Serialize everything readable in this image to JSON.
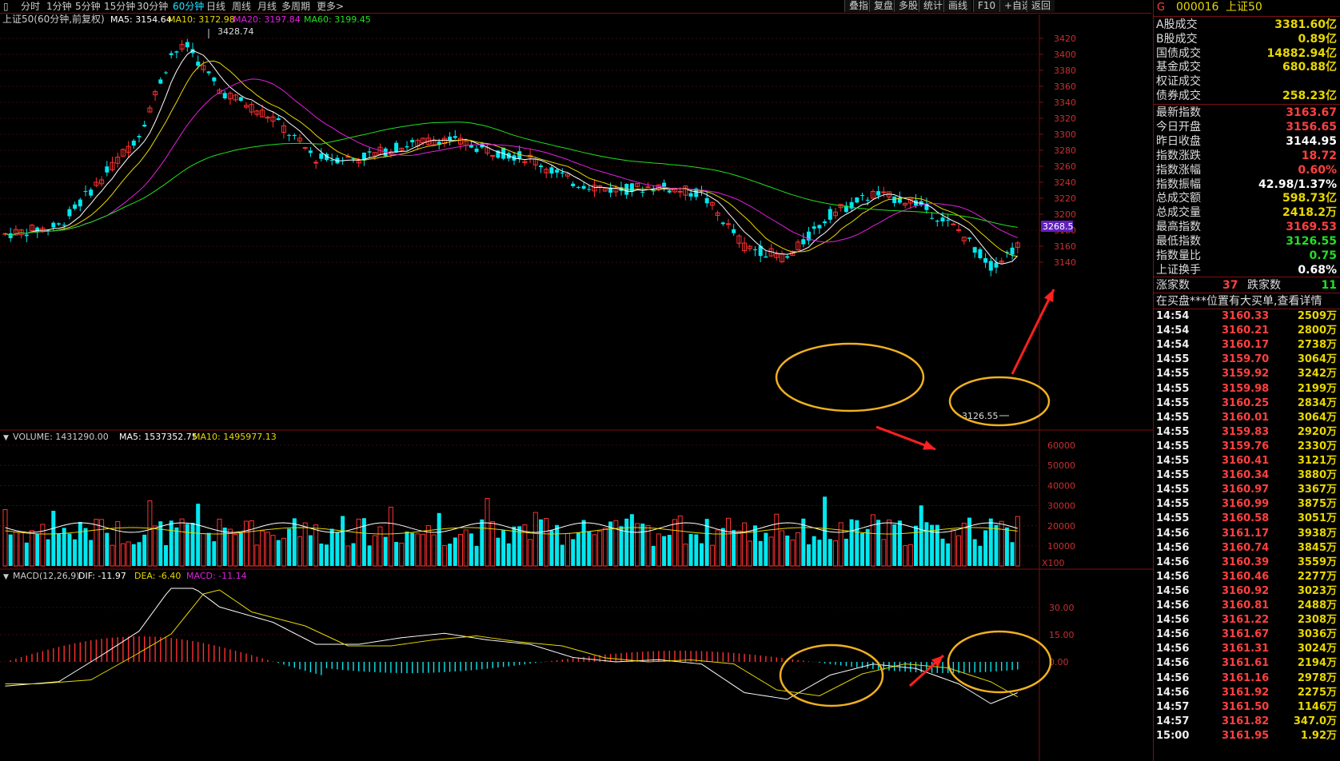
{
  "toolbar": {
    "periods": [
      {
        "label": "分时",
        "active": false
      },
      {
        "label": "1分钟",
        "active": false
      },
      {
        "label": "5分钟",
        "active": false
      },
      {
        "label": "15分钟",
        "active": false
      },
      {
        "label": "30分钟",
        "active": false
      },
      {
        "label": "60分钟",
        "active": true
      },
      {
        "label": "日线",
        "active": false
      },
      {
        "label": "周线",
        "active": false
      },
      {
        "label": "月线",
        "active": false
      },
      {
        "label": "多周期",
        "active": false
      },
      {
        "label": "更多>",
        "active": false
      }
    ],
    "right_buttons": [
      "叠指",
      "复盘",
      "多股",
      "统计",
      "画线",
      "F10",
      "+自选",
      "返回"
    ]
  },
  "main_chart": {
    "title": "上证50(60分钟,前复权)",
    "ma_legend": [
      {
        "label": "MA5: 3154.64",
        "color": "#ffffff"
      },
      {
        "label": "MA10: 3172.98",
        "color": "#e8d800"
      },
      {
        "label": "MA20: 3197.84",
        "color": "#e020e0"
      },
      {
        "label": "MA60: 3199.45",
        "color": "#20e020"
      }
    ],
    "y_ticks": [
      "3420",
      "3400",
      "3380",
      "3360",
      "3340",
      "3320",
      "3300",
      "3280",
      "3260",
      "3240",
      "3220",
      "3200",
      "3180",
      "3160",
      "3140"
    ],
    "current_price_tag": "3268.5",
    "high_label": "3428.74",
    "low_label": "3126.55",
    "high": 3428.74,
    "low": 3126.55
  },
  "volume_chart": {
    "legend": [
      {
        "label": "VOLUME: 1431290.00",
        "color": "#cccccc"
      },
      {
        "label": "MA5: 1537352.75",
        "color": "#ffffff"
      },
      {
        "label": "MA10: 1495977.13",
        "color": "#e8d800"
      }
    ],
    "y_ticks": [
      "60000",
      "50000",
      "40000",
      "30000",
      "20000",
      "10000"
    ],
    "unit": "X100"
  },
  "macd_chart": {
    "legend": [
      {
        "label": "MACD(12,26,9)",
        "color": "#cccccc"
      },
      {
        "label": "DIF: -11.97",
        "color": "#ffffff"
      },
      {
        "label": "DEA: -6.40",
        "color": "#e8d800"
      },
      {
        "label": "MACD: -11.14",
        "color": "#e020e0"
      }
    ],
    "y_ticks": [
      "30.00",
      "15.00",
      "0.00"
    ]
  },
  "panel": {
    "code": "000016",
    "name": "上证50",
    "market_rows": [
      {
        "label": "A股成交",
        "value": "3381.60亿",
        "color": "#e8d800"
      },
      {
        "label": "B股成交",
        "value": "0.89亿",
        "color": "#e8d800"
      },
      {
        "label": "国债成交",
        "value": "14882.94亿",
        "color": "#e8d800"
      },
      {
        "label": "基金成交",
        "value": "680.88亿",
        "color": "#e8d800"
      },
      {
        "label": "权证成交",
        "value": "",
        "color": "#e8d800"
      },
      {
        "label": "债券成交",
        "value": "258.23亿",
        "color": "#e8d800"
      }
    ],
    "index_rows": [
      {
        "label": "最新指数",
        "value": "3163.67",
        "color": "#ff4040"
      },
      {
        "label": "今日开盘",
        "value": "3156.65",
        "color": "#ff4040"
      },
      {
        "label": "昨日收盘",
        "value": "3144.95",
        "color": "#ffffff"
      },
      {
        "label": "指数涨跌",
        "value": "18.72",
        "color": "#ff4040"
      },
      {
        "label": "指数涨幅",
        "value": "0.60%",
        "color": "#ff4040"
      },
      {
        "label": "指数振幅",
        "value": "42.98/1.37%",
        "color": "#ffffff"
      },
      {
        "label": "总成交额",
        "value": "598.73亿",
        "color": "#e8d800"
      },
      {
        "label": "总成交量",
        "value": "2418.2万",
        "color": "#e8d800"
      },
      {
        "label": "最高指数",
        "value": "3169.53",
        "color": "#ff4040"
      },
      {
        "label": "最低指数",
        "value": "3126.55",
        "color": "#20e020"
      },
      {
        "label": "指数量比",
        "value": "0.75",
        "color": "#20e020"
      },
      {
        "label": "上证换手",
        "value": "0.68%",
        "color": "#ffffff"
      }
    ],
    "breadth": {
      "up_label": "涨家数",
      "up_value": "37",
      "down_label": "跌家数",
      "down_value": "11"
    },
    "notice": "在买盘***位置有大买单,查看详情",
    "ticks": [
      {
        "t": "14:54",
        "p": "3160.33",
        "v": "2509万"
      },
      {
        "t": "14:54",
        "p": "3160.21",
        "v": "2800万"
      },
      {
        "t": "14:54",
        "p": "3160.17",
        "v": "2738万"
      },
      {
        "t": "14:55",
        "p": "3159.70",
        "v": "3064万"
      },
      {
        "t": "14:55",
        "p": "3159.92",
        "v": "3242万"
      },
      {
        "t": "14:55",
        "p": "3159.98",
        "v": "2199万"
      },
      {
        "t": "14:55",
        "p": "3160.25",
        "v": "2834万"
      },
      {
        "t": "14:55",
        "p": "3160.01",
        "v": "3064万"
      },
      {
        "t": "14:55",
        "p": "3159.83",
        "v": "2920万"
      },
      {
        "t": "14:55",
        "p": "3159.76",
        "v": "2330万"
      },
      {
        "t": "14:55",
        "p": "3160.41",
        "v": "3121万"
      },
      {
        "t": "14:55",
        "p": "3160.34",
        "v": "3880万"
      },
      {
        "t": "14:55",
        "p": "3160.97",
        "v": "3367万"
      },
      {
        "t": "14:55",
        "p": "3160.99",
        "v": "3875万"
      },
      {
        "t": "14:55",
        "p": "3160.58",
        "v": "3051万"
      },
      {
        "t": "14:56",
        "p": "3161.17",
        "v": "3938万"
      },
      {
        "t": "14:56",
        "p": "3160.74",
        "v": "3845万"
      },
      {
        "t": "14:56",
        "p": "3160.39",
        "v": "3559万"
      },
      {
        "t": "14:56",
        "p": "3160.46",
        "v": "2277万"
      },
      {
        "t": "14:56",
        "p": "3160.92",
        "v": "3023万"
      },
      {
        "t": "14:56",
        "p": "3160.81",
        "v": "2488万"
      },
      {
        "t": "14:56",
        "p": "3161.22",
        "v": "2308万"
      },
      {
        "t": "14:56",
        "p": "3161.67",
        "v": "3036万"
      },
      {
        "t": "14:56",
        "p": "3161.31",
        "v": "3024万"
      },
      {
        "t": "14:56",
        "p": "3161.61",
        "v": "2194万"
      },
      {
        "t": "14:56",
        "p": "3161.16",
        "v": "2978万"
      },
      {
        "t": "14:56",
        "p": "3161.92",
        "v": "2275万"
      },
      {
        "t": "14:57",
        "p": "3161.50",
        "v": "1146万"
      },
      {
        "t": "14:57",
        "p": "3161.82",
        "v": "347.0万"
      },
      {
        "t": "15:00",
        "p": "3161.95",
        "v": "1.92万"
      }
    ]
  },
  "colors": {
    "up": "#ff3030",
    "down": "#00e8f0",
    "grid": "#7a1010",
    "ellipse": "#f0b020",
    "arrow": "#ff2020"
  }
}
